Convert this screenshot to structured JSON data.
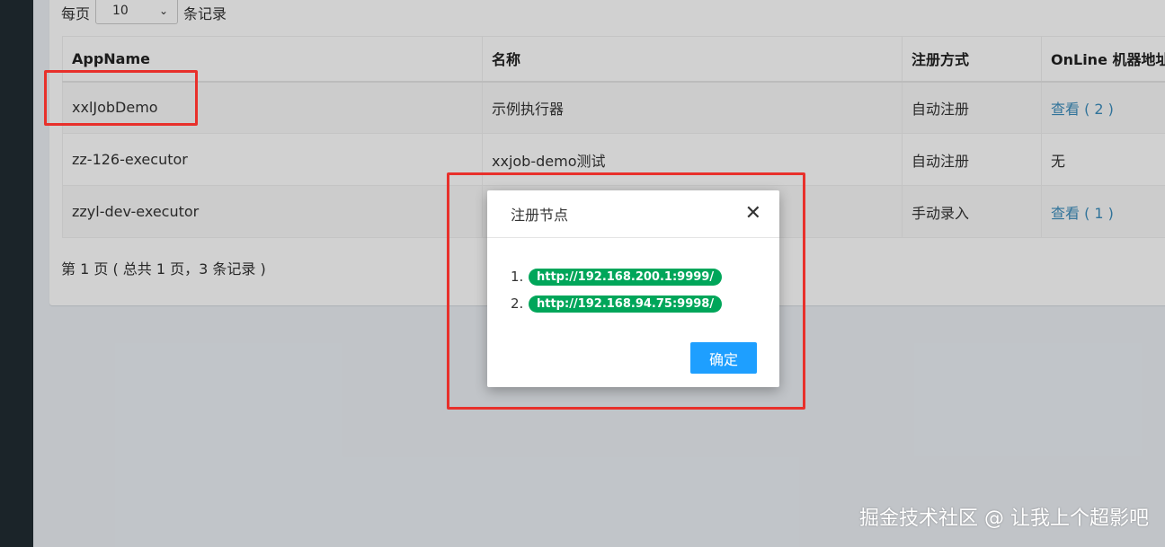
{
  "length": {
    "prefix": "每页",
    "value": "10",
    "suffix": "条记录"
  },
  "table": {
    "headers": [
      "AppName",
      "名称",
      "注册方式",
      "OnLine 机器地址"
    ],
    "rows": [
      {
        "appname": "xxlJobDemo",
        "name": "示例执行器",
        "method": "自动注册",
        "online": "查看 ( 2 )"
      },
      {
        "appname": "zz-126-executor",
        "name": "xxjob-demo测试",
        "method": "自动注册",
        "online": "无"
      },
      {
        "appname": "zzyl-dev-executor",
        "name": "",
        "method": "手动录入",
        "online": "查看 ( 1 )"
      }
    ]
  },
  "pager": {
    "text": "第 1 页 ( 总共 1 页，3 条记录 )"
  },
  "modal": {
    "title": "注册节点",
    "items": [
      {
        "num": "1.",
        "url": "http://192.168.200.1:9999/"
      },
      {
        "num": "2.",
        "url": "http://192.168.94.75:9998/"
      }
    ],
    "ok_label": "确定"
  },
  "watermark": "掘金技术社区 @ 让我上个超影吧",
  "colors": {
    "badge": "#00a65a",
    "ok_button": "#1e9fff",
    "highlight": "#e8302b",
    "link": "#3c8dbc"
  }
}
